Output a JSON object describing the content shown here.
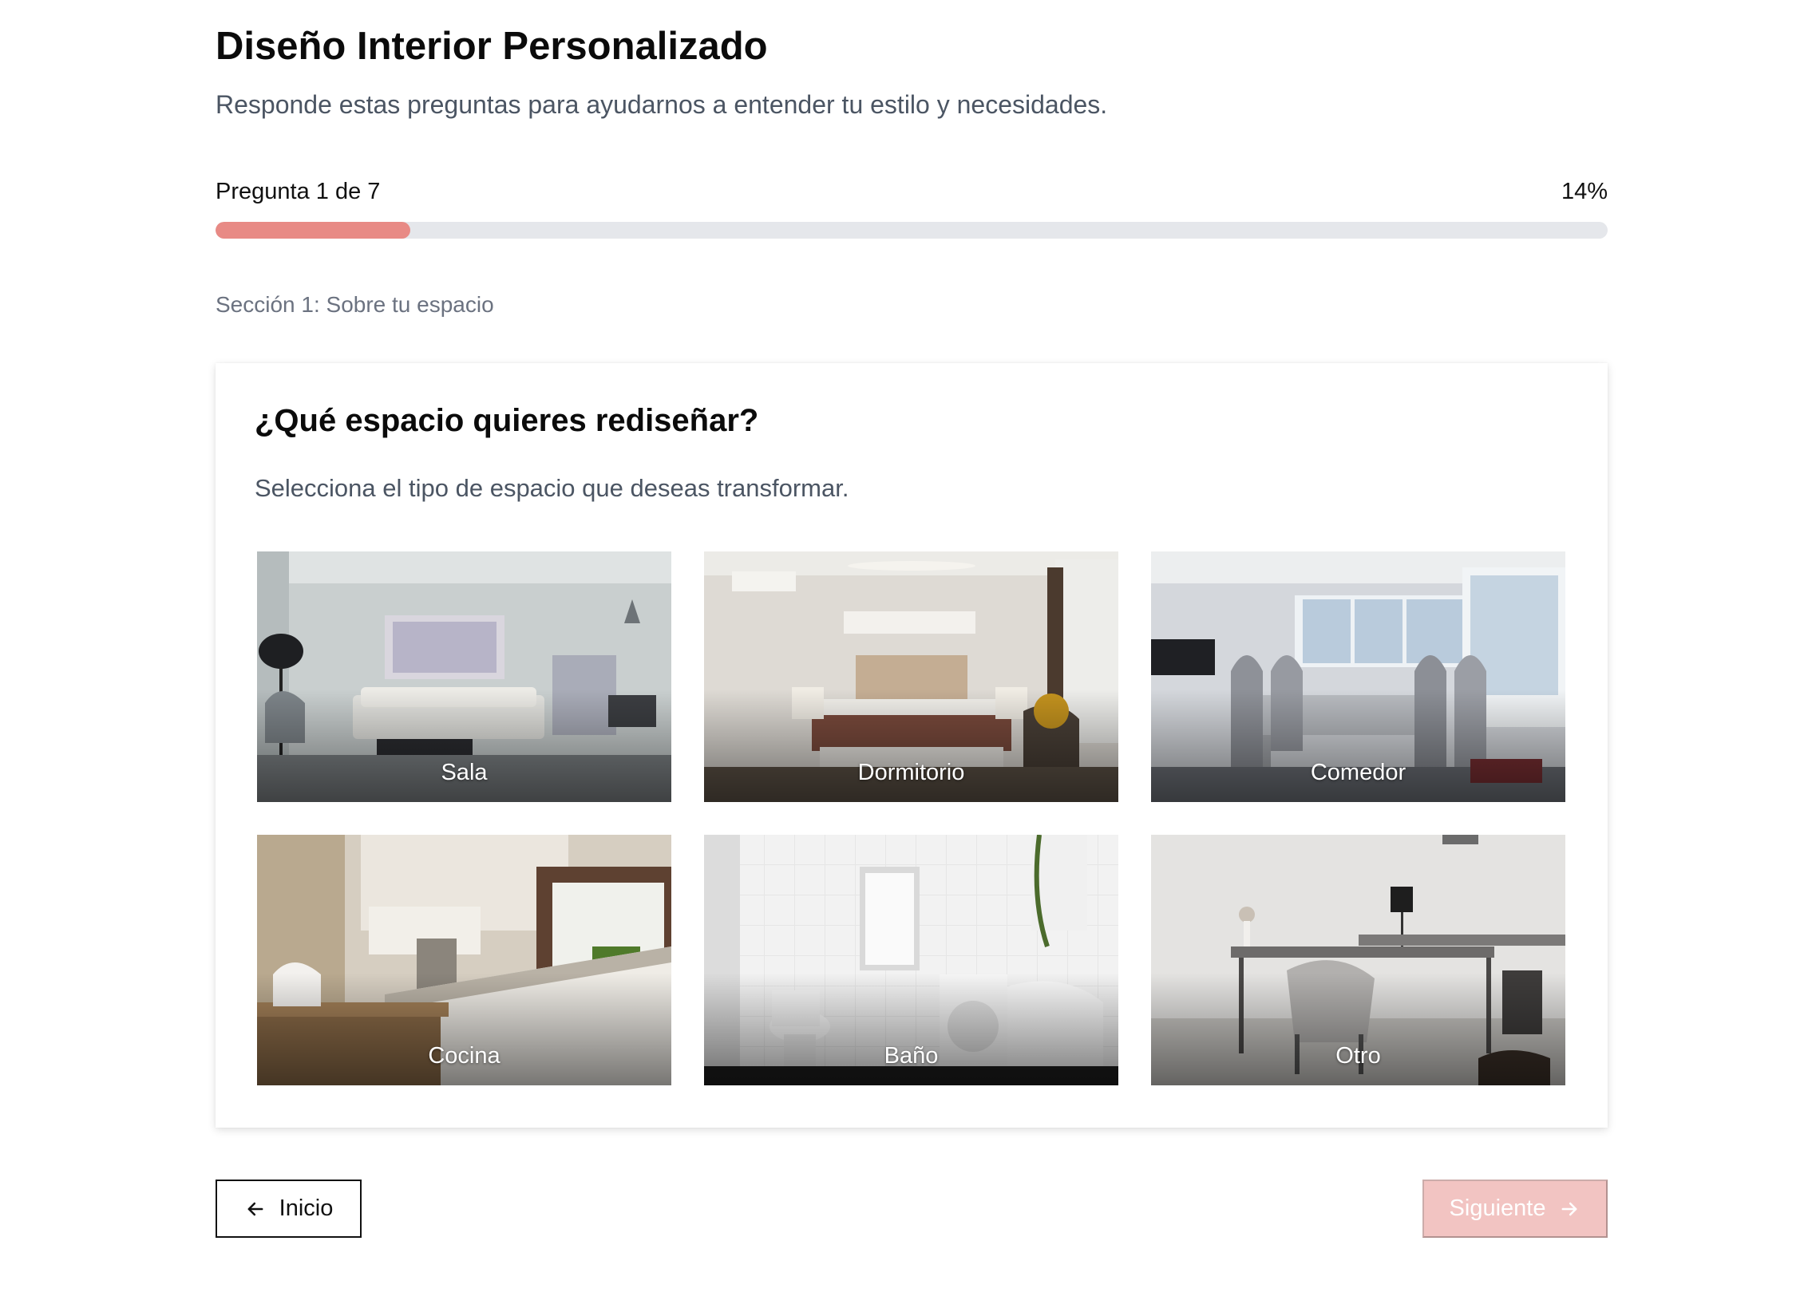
{
  "header": {
    "title": "Diseño Interior Personalizado",
    "subtitle": "Responde estas preguntas para ayudarnos a entender tu estilo y necesidades."
  },
  "progress": {
    "label": "Pregunta 1 de 7",
    "percent_label": "14%",
    "fraction": 0.14
  },
  "section": {
    "label": "Sección 1: Sobre tu espacio"
  },
  "question": {
    "title": "¿Qué espacio quieres rediseñar?",
    "description": "Selecciona el tipo de espacio que deseas transformar.",
    "options": [
      {
        "label": "Sala",
        "image": "living-room-photo"
      },
      {
        "label": "Dormitorio",
        "image": "bedroom-photo"
      },
      {
        "label": "Comedor",
        "image": "dining-room-photo"
      },
      {
        "label": "Cocina",
        "image": "kitchen-photo"
      },
      {
        "label": "Baño",
        "image": "bathroom-photo"
      },
      {
        "label": "Otro",
        "image": "home-office-photo"
      }
    ]
  },
  "nav": {
    "back_label": "Inicio",
    "back_icon": "arrow-left-icon",
    "next_label": "Siguiente",
    "next_icon": "arrow-right-icon",
    "next_enabled": false
  },
  "colors": {
    "accent": "#e88a85",
    "accent_disabled": "#f2c4c2",
    "track": "#e5e7eb",
    "muted_text": "#4b5563"
  }
}
